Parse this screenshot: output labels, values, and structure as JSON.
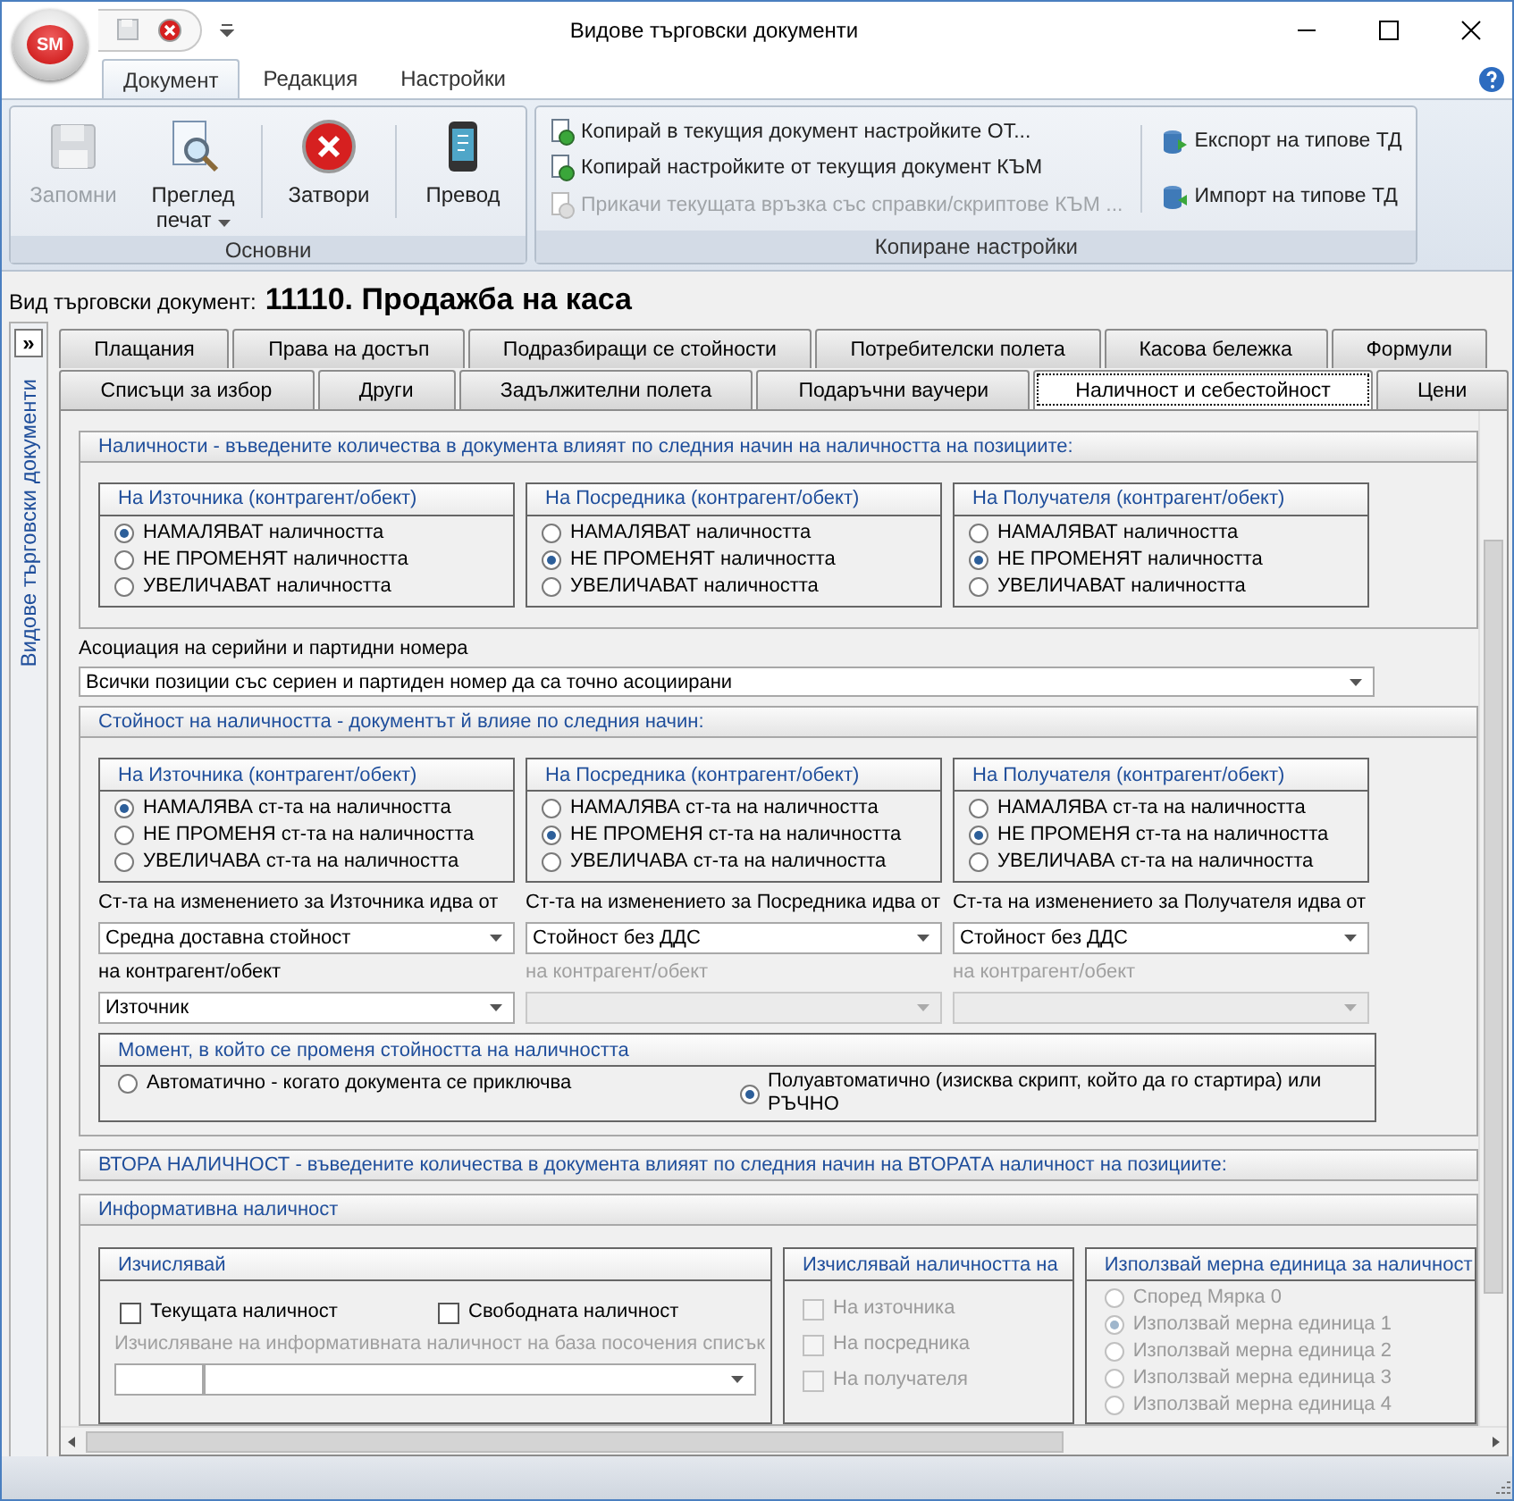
{
  "window": {
    "title": "Видове търговски документи",
    "app_button": "SM"
  },
  "ribbon": {
    "tabs": [
      {
        "label": "Документ",
        "selected": true
      },
      {
        "label": "Редакция",
        "selected": false
      },
      {
        "label": "Настройки",
        "selected": false
      }
    ],
    "groups": [
      {
        "kind": "large",
        "title": "Основни",
        "buttons": [
          {
            "label": "Запомни",
            "disabled": true,
            "dropdown": false
          },
          {
            "label": "Преглед печат",
            "disabled": false,
            "dropdown": true
          },
          {
            "label": "Затвори",
            "disabled": false,
            "dropdown": false
          },
          {
            "label": "Превод",
            "disabled": false,
            "dropdown": false
          }
        ]
      },
      {
        "kind": "small",
        "title": "Копиране настройки",
        "columns": [
          [
            {
              "label": "Копирай в текущия документ настройките ОТ...",
              "disabled": false
            },
            {
              "label": "Копирай настройките от текущия документ КЪМ",
              "disabled": false
            },
            {
              "label": "Прикачи текущата връзка със справки/скриптове КЪМ ...",
              "disabled": true
            }
          ],
          [
            {
              "label": "Експорт на типове ТД",
              "disabled": false
            },
            {
              "label": "Импорт на типове ТД",
              "disabled": false
            }
          ]
        ]
      }
    ]
  },
  "document": {
    "label": "Вид търговски документ:",
    "value": "11110. Продажба на каса"
  },
  "side_panel": {
    "toggle": "»",
    "title": "Видове търговски документи"
  },
  "tabs": [
    [
      {
        "label": "Плащания",
        "selected": false
      },
      {
        "label": "Права на достъп",
        "selected": false
      },
      {
        "label": "Подразбиращи се стойности",
        "selected": false
      },
      {
        "label": "Потребителски полета",
        "selected": false
      },
      {
        "label": "Касова бележка",
        "selected": false
      },
      {
        "label": "Формули",
        "selected": false
      }
    ],
    [
      {
        "label": "Списъци за избор",
        "selected": false
      },
      {
        "label": "Други",
        "selected": false
      },
      {
        "label": "Задължителни полета",
        "selected": false
      },
      {
        "label": "Подаръчни ваучери",
        "selected": false
      },
      {
        "label": "Наличност и себестойност",
        "selected": true
      },
      {
        "label": "Цени",
        "selected": false
      }
    ]
  ],
  "stock": {
    "title": "Наличности - въведените количества в документа влияят по следния начин на наличността на позициите:",
    "groups": [
      {
        "title": "На Източника (контрагент/обект)",
        "options": [
          {
            "label": "НАМАЛЯВАТ наличността",
            "selected": true
          },
          {
            "label": "НЕ ПРОМЕНЯТ наличността",
            "selected": false
          },
          {
            "label": "УВЕЛИЧАВАТ наличността",
            "selected": false
          }
        ]
      },
      {
        "title": "На Посредника (контрагент/обект)",
        "options": [
          {
            "label": "НАМАЛЯВАТ наличността",
            "selected": false
          },
          {
            "label": "НЕ ПРОМЕНЯТ наличността",
            "selected": true
          },
          {
            "label": "УВЕЛИЧАВАТ наличността",
            "selected": false
          }
        ]
      },
      {
        "title": "На Получателя (контрагент/обект)",
        "options": [
          {
            "label": "НАМАЛЯВАТ наличността",
            "selected": false
          },
          {
            "label": "НЕ ПРОМЕНЯТ наличността",
            "selected": true
          },
          {
            "label": "УВЕЛИЧАВАТ наличността",
            "selected": false
          }
        ]
      }
    ]
  },
  "association": {
    "label": "Асоциация на серийни и партидни номера",
    "value": "Всички позиции със сериен и партиден номер да са точно асоциирани"
  },
  "value_section": {
    "title": "Стойност на наличността - документът й влияе по следния начин:",
    "groups": [
      {
        "title": "На Източника (контрагент/обект)",
        "options": [
          {
            "label": "НАМАЛЯВА ст-та на наличността",
            "selected": true
          },
          {
            "label": "НЕ ПРОМЕНЯ ст-та на наличността",
            "selected": false
          },
          {
            "label": "УВЕЛИЧАВА ст-та на наличността",
            "selected": false
          }
        ]
      },
      {
        "title": "На Посредника (контрагент/обект)",
        "options": [
          {
            "label": "НАМАЛЯВА ст-та на наличността",
            "selected": false
          },
          {
            "label": "НЕ ПРОМЕНЯ ст-та на наличността",
            "selected": true
          },
          {
            "label": "УВЕЛИЧАВА ст-та на наличността",
            "selected": false
          }
        ]
      },
      {
        "title": "На Получателя (контрагент/обект)",
        "options": [
          {
            "label": "НАМАЛЯВА ст-та на наличността",
            "selected": false
          },
          {
            "label": "НЕ ПРОМЕНЯ ст-та на наличността",
            "selected": true
          },
          {
            "label": "УВЕЛИЧАВА ст-та на наличността",
            "selected": false
          }
        ]
      }
    ],
    "sources": [
      {
        "label": "Ст-та на изменението за Източника идва от",
        "value": "Средна доставна стойност",
        "contragent_label": "на контрагент/обект",
        "contragent_value": "Източник",
        "contragent_disabled": false
      },
      {
        "label": "Ст-та на изменението за Посредника идва от",
        "value": "Стойност без ДДС",
        "contragent_label": "на контрагент/обект",
        "contragent_disabled": true
      },
      {
        "label": "Ст-та на изменението за Получателя идва от",
        "value": "Стойност без ДДС",
        "contragent_label": "на контрагент/обект",
        "contragent_disabled": true
      }
    ],
    "moment": {
      "title": "Момент, в който се променя стойността на наличността",
      "options": [
        {
          "label": "Автоматично - когато документа се приключва",
          "selected": false
        },
        {
          "label": "Полуавтоматично (изисква скрипт, който да го стартира) или РЪЧНО",
          "selected": true
        }
      ]
    }
  },
  "second_stock": {
    "title": "ВТОРА НАЛИЧНОСТ - въведените количества в документа влияят по следния начин на ВТОРАТА наличност на позициите:"
  },
  "informative": {
    "title": "Информативна наличност",
    "calculate": {
      "title": "Изчислявай",
      "checkboxes": [
        {
          "label": "Текущата наличност",
          "checked": false
        },
        {
          "label": "Свободната наличност",
          "checked": false
        }
      ],
      "list_label": "Изчисляване на информативната наличност на база посочения списък"
    },
    "targets": {
      "title": "Изчислявай наличността на",
      "disabled": true,
      "checkboxes": [
        {
          "label": "На източника",
          "checked": false
        },
        {
          "label": "На посредника",
          "checked": false
        },
        {
          "label": "На получателя",
          "checked": false
        }
      ]
    },
    "unit": {
      "title": "Използвай мерна единица за наличност",
      "disabled": true,
      "options": [
        {
          "label": "Според Мярка 0",
          "selected": false
        },
        {
          "label": "Използвай мерна единица 1",
          "selected": true
        },
        {
          "label": "Използвай мерна единица 2",
          "selected": false
        },
        {
          "label": "Използвай мерна единица 3",
          "selected": false
        },
        {
          "label": "Използвай мерна единица 4",
          "selected": false
        }
      ]
    }
  }
}
